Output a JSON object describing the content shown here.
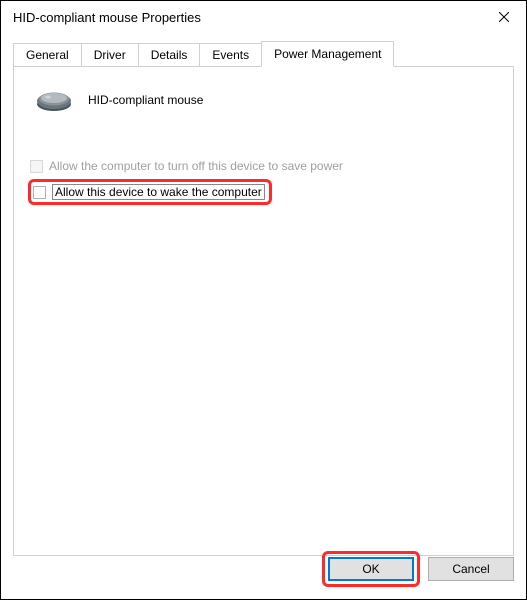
{
  "window": {
    "title": "HID-compliant mouse Properties"
  },
  "tabs": {
    "general": "General",
    "driver": "Driver",
    "details": "Details",
    "events": "Events",
    "power": "Power Management"
  },
  "device": {
    "name": "HID-compliant mouse"
  },
  "options": {
    "allow_turn_off": "Allow the computer to turn off this device to save power",
    "allow_wake": "Allow this device to wake the computer"
  },
  "buttons": {
    "ok": "OK",
    "cancel": "Cancel"
  }
}
